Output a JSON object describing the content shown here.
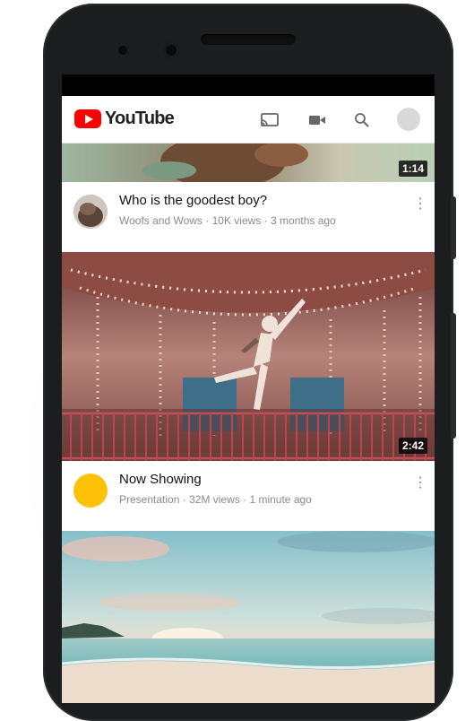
{
  "app": {
    "logo_text": "YouTube",
    "brand_color": "#ff0000"
  },
  "icons": [
    "cast-icon",
    "video-camera-icon",
    "search-icon",
    "account-avatar"
  ],
  "videos": [
    {
      "duration": "1:14",
      "title": "Who is the goodest boy?",
      "channel": "Woofs and Wows",
      "views": "10K views",
      "age": "3 months ago"
    },
    {
      "duration": "2:42",
      "title": "Now Showing",
      "channel": "Presentation",
      "views": "32M views",
      "age": "1 minute ago",
      "avatar_color": "#ffc107"
    }
  ],
  "separator": "·"
}
